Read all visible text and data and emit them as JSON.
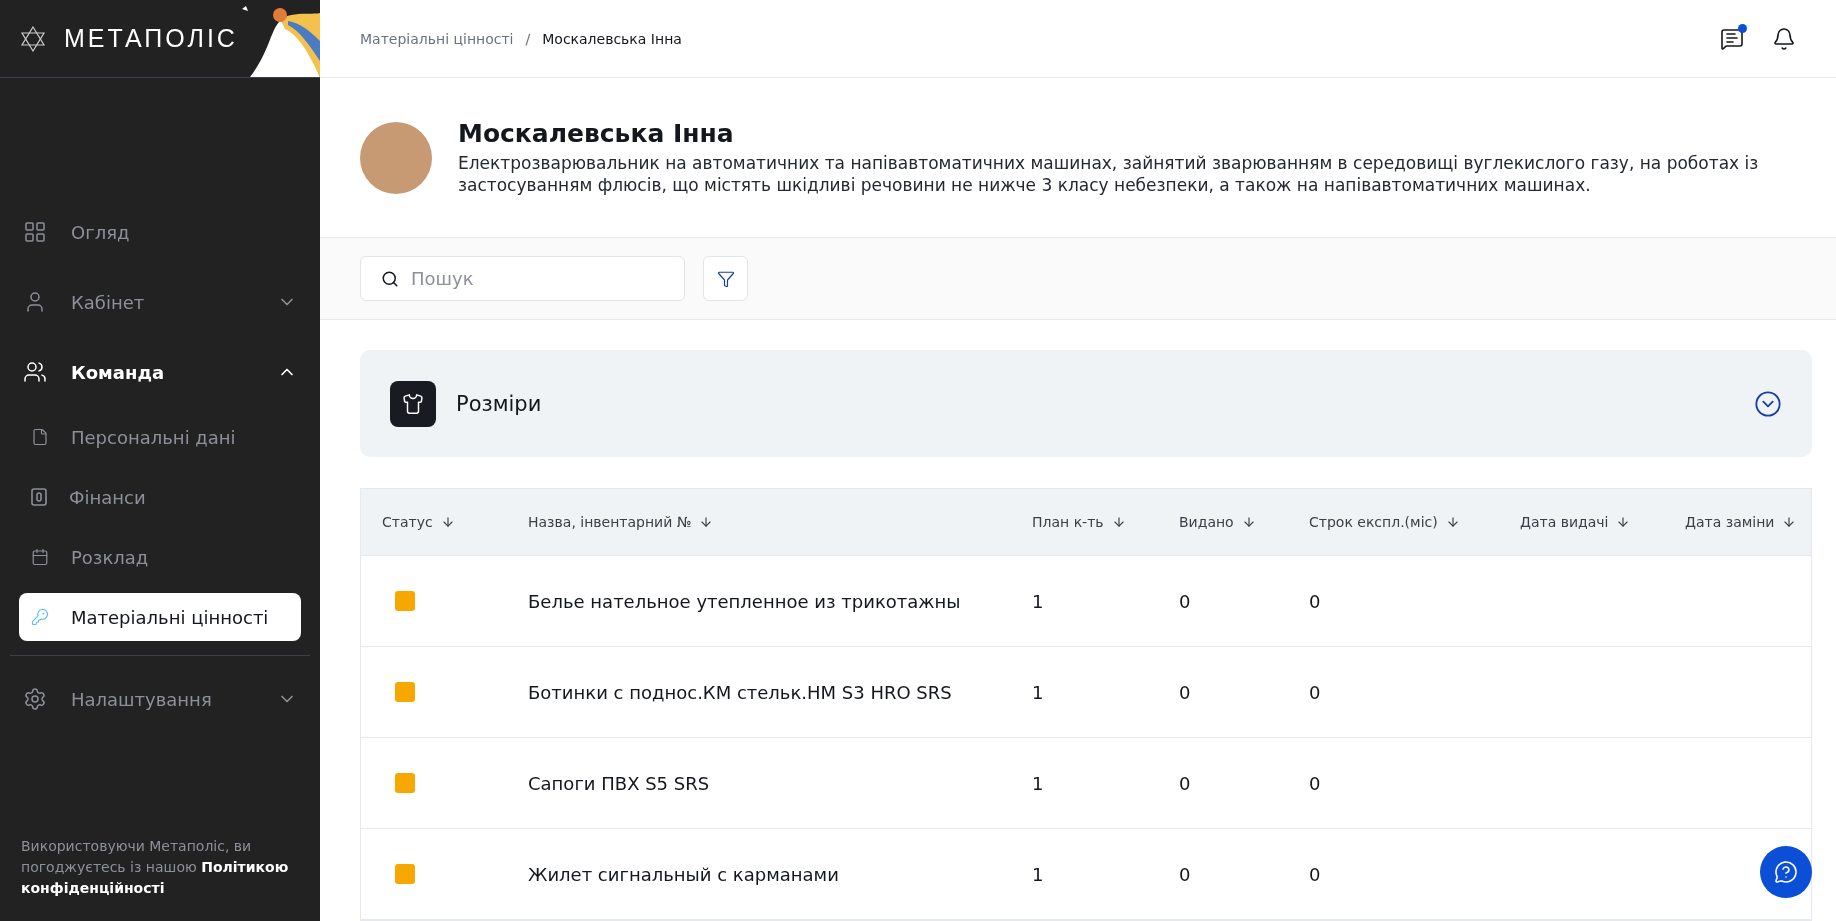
{
  "logo": {
    "text": "МЕТАПОЛІС"
  },
  "sidebar": {
    "groups": [
      [
        {
          "label": "Огляд"
        },
        {
          "label": "Кабінет",
          "expanded": false
        },
        {
          "label": "Команда",
          "expanded": true,
          "children": [
            {
              "label": "Персональні дані",
              "selected": false
            },
            {
              "label": "Фінанси",
              "selected": false
            },
            {
              "label": "Розклад",
              "selected": false
            },
            {
              "label": "Матеріальні цінності",
              "selected": true
            }
          ]
        }
      ],
      [
        {
          "label": "Налаштування",
          "expanded": false
        }
      ]
    ],
    "footer": "Використовуючи Метаполіс, ви погоджуєтесь із нашою **Політикою конфіденційності**"
  },
  "header": {
    "breadcrumbs": [
      "Матеріальні цінності",
      "Москалевська Інна"
    ],
    "separator": "/",
    "messages_unread": true
  },
  "profile": {
    "name": "Москалевська Інна",
    "position": "Електрозварювальник на автоматичних та напівавтоматичних машинах, зайнятий зварюванням в середовищі вуглекислого газу, на роботах із застосуванням флюсів, що містять шкідливі речовини не нижче 3 класу небезпеки, а також на напівавтоматичних машинах."
  },
  "search": {
    "placeholder": "Пошук"
  },
  "section": {
    "title": "Розміри",
    "expanded": false
  },
  "table": {
    "columns": [
      "Статус",
      "Назва, інвентарний №",
      "План к-ть",
      "Видано",
      "Строк експл.(міс)",
      "Дата видачі",
      "Дата заміни"
    ],
    "rows": [
      {
        "color": "#f7a800",
        "name": "Белье нательное утепленное из трикотажны",
        "plan": "1",
        "issued": "0",
        "term": "0"
      },
      {
        "color": "#f7a800",
        "name": "Ботинки с поднос.КМ стельк.НМ S3 HRO SRS",
        "plan": "1",
        "issued": "0",
        "term": "0"
      },
      {
        "color": "#f7a800",
        "name": "Сапоги ПВХ S5 SRS",
        "plan": "1",
        "issued": "0",
        "term": "0"
      },
      {
        "color": "#f7a800",
        "name": "Жилет сигнальный с карманами",
        "plan": "1",
        "issued": "0",
        "term": "0"
      }
    ]
  }
}
